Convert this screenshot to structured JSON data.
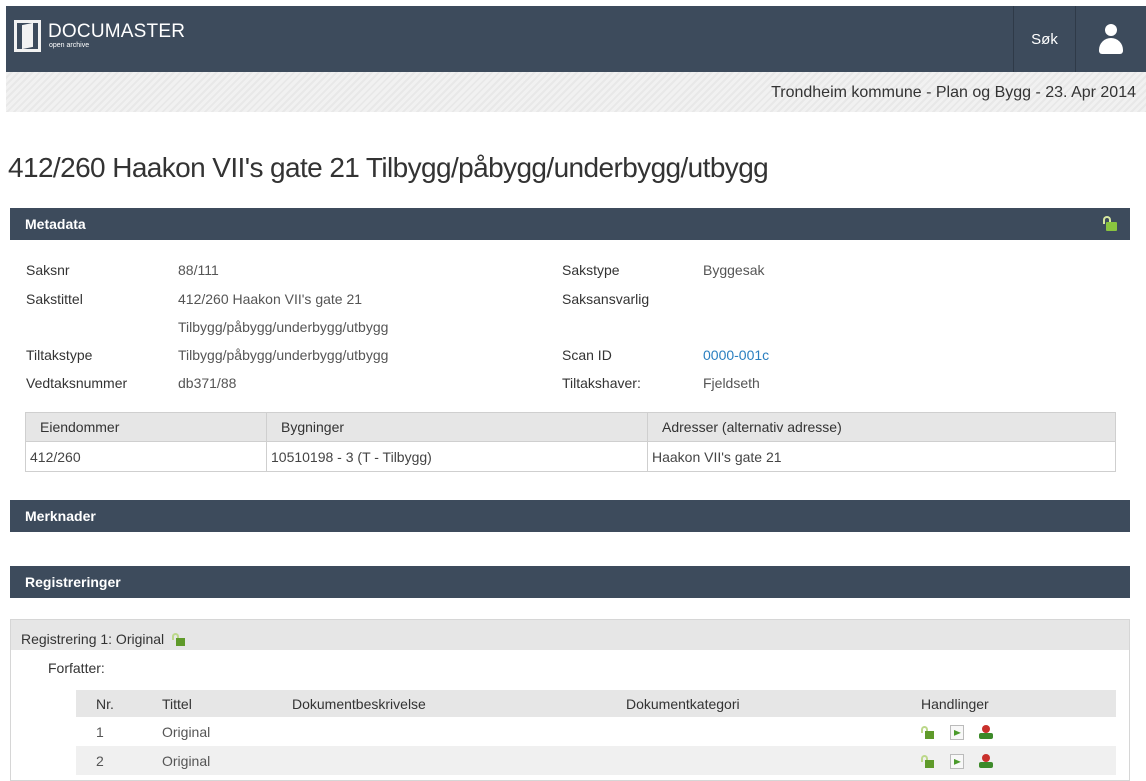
{
  "header": {
    "logo_title": "DOCUMASTER",
    "logo_subtitle": "open archive",
    "search_label": "Søk",
    "user_icon": "user-icon"
  },
  "context": {
    "text": "Trondheim kommune - Plan og Bygg - 23. Apr 2014"
  },
  "page": {
    "title": "412/260 Haakon VII's gate 21 Tilbygg/påbygg/underbygg/utbygg"
  },
  "metadata": {
    "section_title": "Metadata",
    "left": [
      {
        "label": "Saksnr",
        "value": "88/111"
      },
      {
        "label": "Sakstittel",
        "value": "412/260 Haakon VII's gate 21",
        "value2": "Tilbygg/påbygg/underbygg/utbygg"
      },
      {
        "label": "Tiltakstype",
        "value": "Tilbygg/påbygg/underbygg/utbygg"
      },
      {
        "label": "Vedtaksnummer",
        "value": "db371/88"
      }
    ],
    "right": [
      {
        "label": "Sakstype",
        "value": "Byggesak"
      },
      {
        "label": "Saksansvarlig",
        "value": ""
      },
      {
        "label": "Scan ID",
        "value": "0000-001c"
      },
      {
        "label": "Tiltakshaver:",
        "value": "Fjeldseth"
      }
    ],
    "properties_table": {
      "headers": [
        "Eiendommer",
        "Bygninger",
        "Adresser (alternativ adresse)"
      ],
      "rows": [
        [
          "412/260",
          "10510198 - 3 (T - Tilbygg)",
          "Haakon VII's gate 21"
        ]
      ]
    }
  },
  "merknader": {
    "section_title": "Merknader"
  },
  "registreringer": {
    "section_title": "Registreringer",
    "registrering": {
      "title": "Registrering 1: Original",
      "forfatter_label": "Forfatter:",
      "headers": [
        "Nr.",
        "Tittel",
        "Dokumentbeskrivelse",
        "Dokumentkategori",
        "Handlinger"
      ],
      "rows": [
        {
          "nr": "1",
          "tittel": "Original",
          "beskrivelse": "",
          "kategori": ""
        },
        {
          "nr": "2",
          "tittel": "Original",
          "beskrivelse": "",
          "kategori": ""
        }
      ]
    }
  },
  "colors": {
    "nav_bg": "#3d4b5c",
    "link": "#2a7fc0",
    "lock_green": "#8ac43f"
  }
}
